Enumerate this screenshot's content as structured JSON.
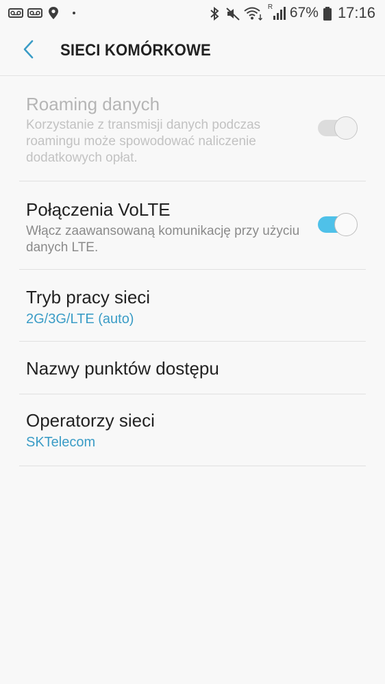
{
  "status_bar": {
    "left_icons": [
      "voicemail-icon",
      "voicemail-icon",
      "location-icon",
      "dot-icon"
    ],
    "right_icons": [
      "bluetooth-icon",
      "mute-icon",
      "wifi-icon",
      "signal-icon",
      "battery-icon"
    ],
    "signal_label": "R",
    "battery_percent": "67%",
    "time": "17:16"
  },
  "header": {
    "back_icon": "back-arrow-icon",
    "title": "SIECI KOMÓRKOWE"
  },
  "settings": [
    {
      "title": "Roaming danych",
      "description": "Korzystanie z transmisji danych podczas roamingu może spowodować naliczenie dodatkowych opłat.",
      "toggle": "off",
      "enabled": false
    },
    {
      "title": "Połączenia VoLTE",
      "description": "Włącz zaawansowaną komunikację przy użyciu danych LTE.",
      "toggle": "on",
      "enabled": true
    },
    {
      "title": "Tryb pracy sieci",
      "subtitle": "2G/3G/LTE (auto)"
    },
    {
      "title": "Nazwy punktów dostępu"
    },
    {
      "title": "Operatorzy sieci",
      "subtitle": "SKTelecom"
    }
  ],
  "colors": {
    "accent": "#3a9cc6",
    "toggle_on_track": "#4fc1e9",
    "toggle_off_track": "#d9d9d9",
    "background": "#f8f8f8"
  }
}
